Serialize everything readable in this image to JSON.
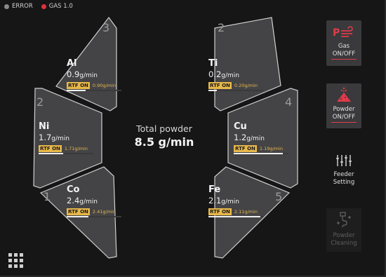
{
  "status": {
    "error_label": "ERROR",
    "error_color": "#8a8a8a",
    "gas_label": "GAS 1.0",
    "gas_color": "#e0303c"
  },
  "feeders": [
    {
      "id": "al",
      "slot": "3",
      "name": "Al",
      "rate": "0.9",
      "unit": "g/min",
      "rtf_label": "RTF ON",
      "rtf_value": "0.90g/min",
      "bar_fraction": 0.35
    },
    {
      "id": "ti",
      "slot": "2",
      "name": "Ti",
      "rate": "0.2",
      "unit": "g/min",
      "rtf_label": "RTF ON",
      "rtf_value": "0.20g/min",
      "bar_fraction": 0.15
    },
    {
      "id": "ni",
      "slot": "2",
      "name": "Ni",
      "rate": "1.7",
      "unit": "g/min",
      "rtf_label": "RTF ON",
      "rtf_value": "1.71g/min",
      "bar_fraction": 0.45
    },
    {
      "id": "cu",
      "slot": "4",
      "name": "Cu",
      "rate": "1.2",
      "unit": "g/min",
      "rtf_label": "RTF ON",
      "rtf_value": "1.19g/min",
      "bar_fraction": 0.9
    },
    {
      "id": "co",
      "slot": "1",
      "name": "Co",
      "rate": "2.4",
      "unit": "g/min",
      "rtf_label": "RTF ON",
      "rtf_value": "2.41g/min",
      "bar_fraction": 0.4
    },
    {
      "id": "fe",
      "slot": "5",
      "name": "Fe",
      "rate": "2.1",
      "unit": "g/min",
      "rtf_label": "RTF ON",
      "rtf_value": "2.11g/min",
      "bar_fraction": 0.95
    }
  ],
  "total": {
    "label": "Total powder",
    "value": "8.5 g/min"
  },
  "sidebar": {
    "gas": {
      "line1": "Gas",
      "line2": "ON/OFF",
      "icon": "gas-flow-icon",
      "accent": "#e03a4a"
    },
    "powder": {
      "line1": "Powder",
      "line2": "ON/OFF",
      "icon": "powder-pile-icon",
      "accent": "#e03a4a"
    },
    "feeder": {
      "line1": "Feeder",
      "line2": "Setting",
      "icon": "sliders-icon"
    },
    "cleaning": {
      "line1": "Powder",
      "line2": "Cleaning",
      "icon": "cleaning-icon",
      "disabled": true
    }
  },
  "bottom": {
    "menu_icon": "grid-menu-icon"
  }
}
